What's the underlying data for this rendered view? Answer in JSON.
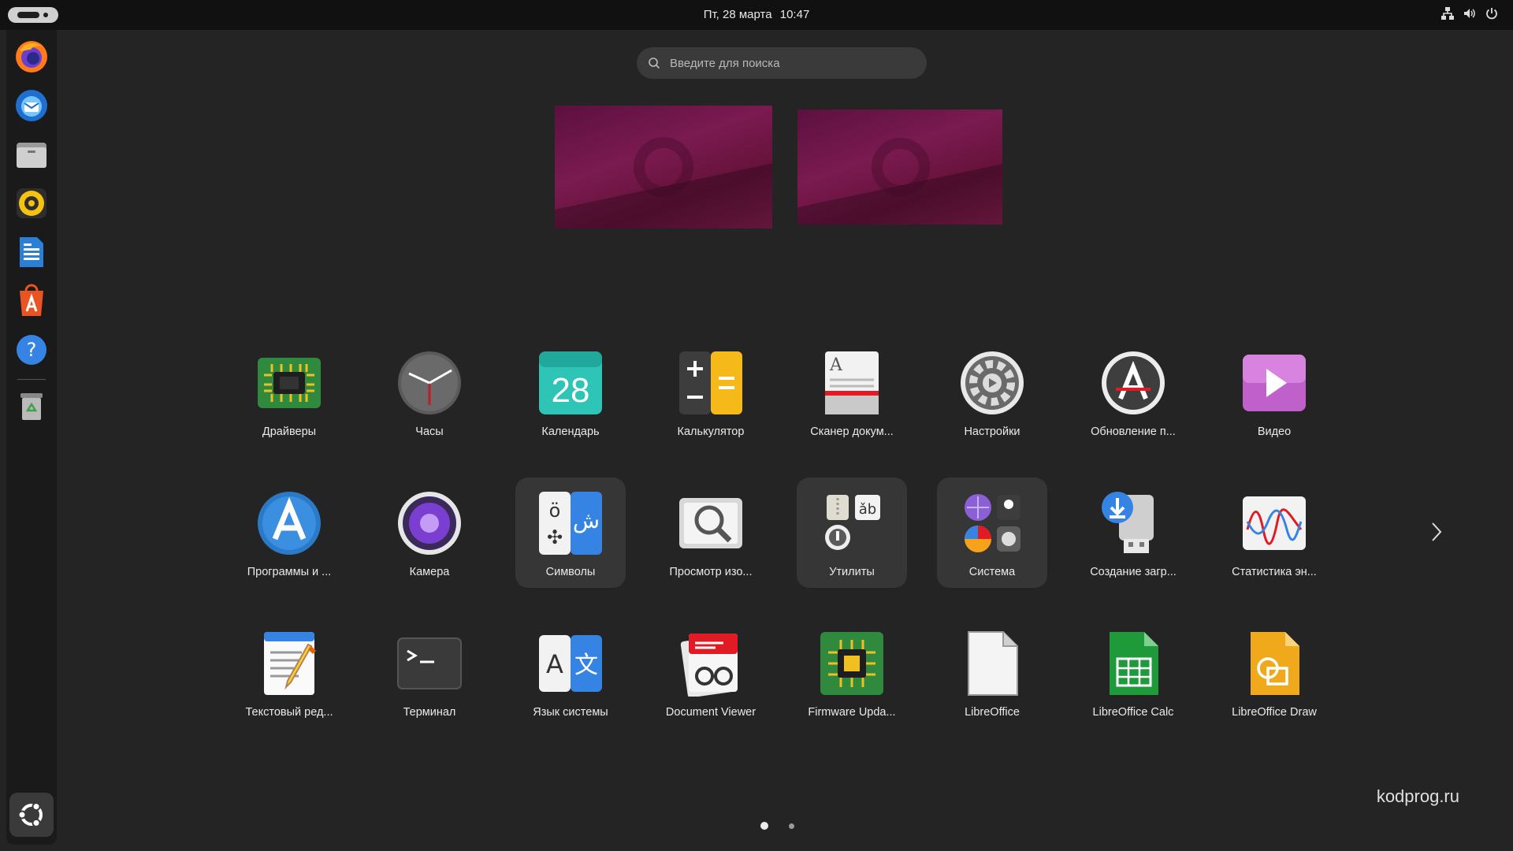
{
  "topbar": {
    "clock_date": "Пт, 28 марта",
    "clock_time": "10:47",
    "tray_icons": [
      "network-icon",
      "volume-icon",
      "power-icon"
    ]
  },
  "dock": {
    "items": [
      "firefox",
      "thunderbird",
      "files",
      "rhythmbox",
      "libreoffice-writer",
      "app-center",
      "help",
      "trash"
    ],
    "show_apps": "show-applications"
  },
  "search": {
    "placeholder": "Введите для поиска"
  },
  "apps": [
    {
      "label": "Драйверы"
    },
    {
      "label": "Часы"
    },
    {
      "label": "Календарь",
      "icon_text": "28"
    },
    {
      "label": "Калькулятор"
    },
    {
      "label": "Сканер докум..."
    },
    {
      "label": "Настройки"
    },
    {
      "label": "Обновление п..."
    },
    {
      "label": "Видео"
    },
    {
      "label": "Программы и ..."
    },
    {
      "label": "Камера"
    },
    {
      "label": "Символы"
    },
    {
      "label": "Просмотр изо..."
    },
    {
      "label": "Утилиты"
    },
    {
      "label": "Система"
    },
    {
      "label": "Создание загр..."
    },
    {
      "label": "Статистика эн..."
    },
    {
      "label": "Текстовый ред..."
    },
    {
      "label": "Терминал"
    },
    {
      "label": "Язык системы"
    },
    {
      "label": "Document Viewer"
    },
    {
      "label": "Firmware Upda..."
    },
    {
      "label": "LibreOffice"
    },
    {
      "label": "LibreOffice Calc"
    },
    {
      "label": "LibreOffice Draw"
    }
  ],
  "pagination": {
    "pages": 2,
    "current": 1
  },
  "watermark": "kodprog.ru",
  "colors": {
    "background": "#242424",
    "topbar": "#111111",
    "accent": "#e95420"
  }
}
